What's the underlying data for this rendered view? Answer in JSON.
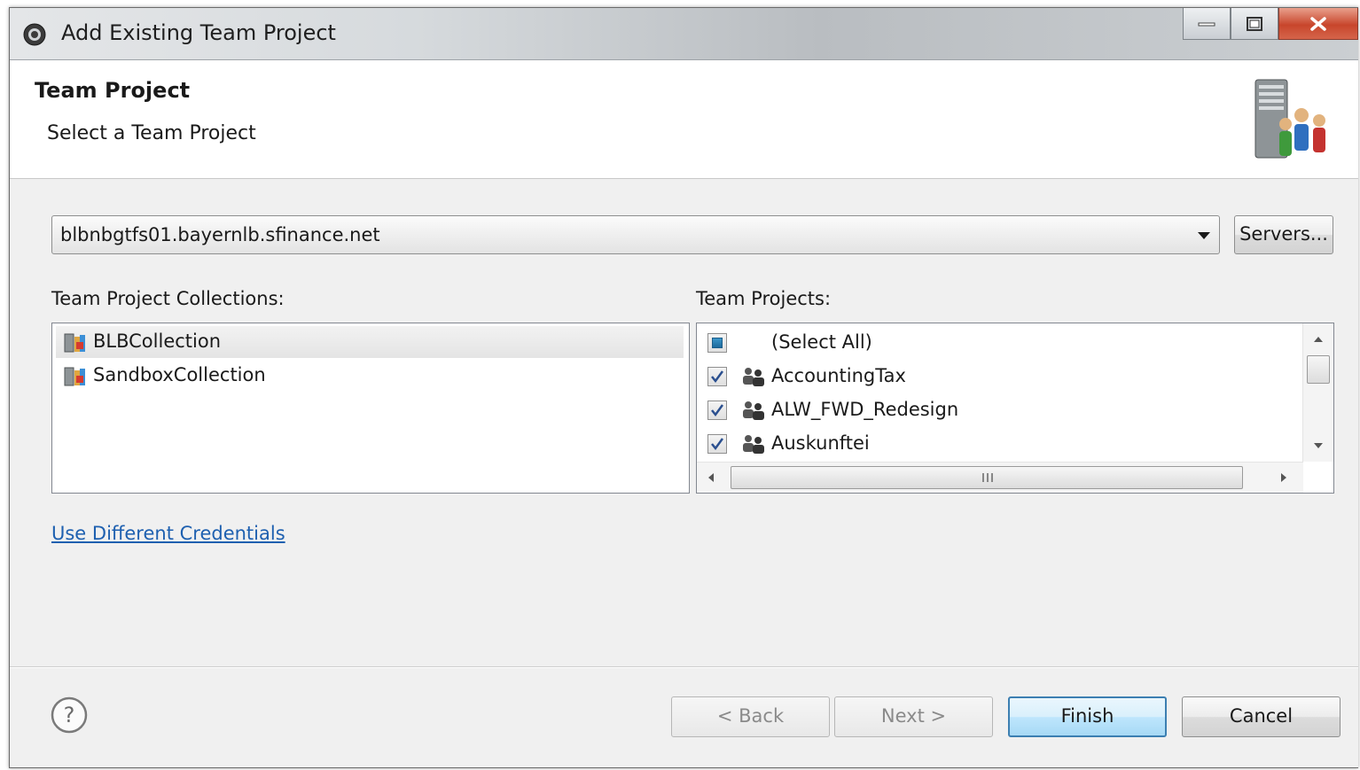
{
  "window": {
    "title": "Add Existing Team Project"
  },
  "header": {
    "title": "Team Project",
    "subtitle": "Select a Team Project"
  },
  "server": {
    "selected": "blbnbgtfs01.bayernlb.sfinance.net",
    "servers_button": "Servers..."
  },
  "collections": {
    "label": "Team Project Collections:",
    "items": [
      {
        "name": "BLBCollection",
        "selected": true
      },
      {
        "name": "SandboxCollection",
        "selected": false
      }
    ]
  },
  "projects": {
    "label": "Team Projects:",
    "select_all": "(Select All)",
    "items": [
      {
        "name": "AccountingTax",
        "checked": true
      },
      {
        "name": "ALW_FWD_Redesign",
        "checked": true
      },
      {
        "name": "Auskunftei",
        "checked": true
      }
    ]
  },
  "credentials_link": "Use Different Credentials",
  "footer": {
    "back": "< Back",
    "next": "Next >",
    "finish": "Finish",
    "cancel": "Cancel"
  },
  "icons": {
    "app": "eclipse-icon",
    "header": "server-team-icon",
    "collection": "collection-icon",
    "project": "team-icon",
    "help": "help-icon"
  },
  "colors": {
    "link": "#1e60b0",
    "default_button_border": "#3c7fb1",
    "close_button": "#c8462c"
  }
}
